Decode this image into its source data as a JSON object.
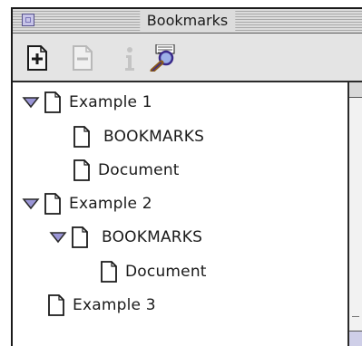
{
  "window": {
    "title": "Bookmarks"
  },
  "toolbar": {
    "buttons": [
      {
        "icon": "new-bookmark-icon",
        "enabled": true
      },
      {
        "icon": "delete-bookmark-icon",
        "enabled": false
      },
      {
        "icon": "info-icon",
        "enabled": false
      },
      {
        "icon": "find-icon",
        "enabled": true
      }
    ]
  },
  "outline": {
    "items": [
      {
        "label": "Example 1",
        "expanded": true
      },
      {
        "label": "BOOKMARKS",
        "expanded": false
      },
      {
        "label": "Document",
        "expanded": false
      },
      {
        "label": "Example 2",
        "expanded": true
      },
      {
        "label": "BOOKMARKS",
        "expanded": true
      },
      {
        "label": "Document",
        "expanded": false
      },
      {
        "label": "Example 3",
        "expanded": false
      }
    ]
  },
  "colors": {
    "disclosure_triangle": "#9a95d6",
    "titlebar": "#dcdcdc",
    "toolbar": "#e4e4e4"
  }
}
